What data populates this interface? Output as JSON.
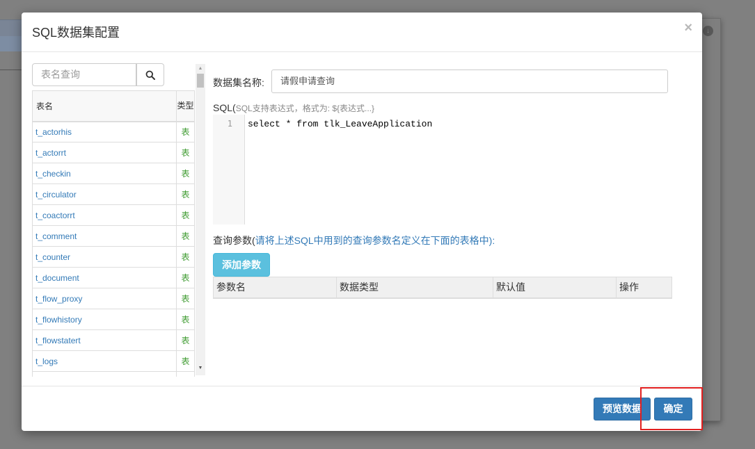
{
  "modal": {
    "title": "SQL数据集配置",
    "close_icon": "×"
  },
  "table_panel": {
    "search_placeholder": "表名查询",
    "headers": {
      "name": "表名",
      "type": "类型"
    },
    "rows": [
      {
        "name": "t_actorhis",
        "type": "表"
      },
      {
        "name": "t_actorrt",
        "type": "表"
      },
      {
        "name": "t_checkin",
        "type": "表"
      },
      {
        "name": "t_circulator",
        "type": "表"
      },
      {
        "name": "t_coactorrt",
        "type": "表"
      },
      {
        "name": "t_comment",
        "type": "表"
      },
      {
        "name": "t_counter",
        "type": "表"
      },
      {
        "name": "t_document",
        "type": "表"
      },
      {
        "name": "t_flow_proxy",
        "type": "表"
      },
      {
        "name": "t_flowhistory",
        "type": "表"
      },
      {
        "name": "t_flowstatert",
        "type": "表"
      },
      {
        "name": "t_logs",
        "type": "表"
      },
      {
        "name": "",
        "type": ""
      }
    ]
  },
  "form": {
    "name_label": "数据集名称:",
    "name_value": "请假申请查询",
    "sql_label": "SQL(",
    "sql_hint": "SQL支持表达式，格式为: ${表达式...}",
    "sql_line_number": "1",
    "sql_code": "select * from tlk_LeaveApplication",
    "params_label": "查询参数(",
    "params_hint": "请将上述SQL中用到的查询参数名定义在下面的表格中):",
    "add_param_label": "添加参数",
    "param_headers": [
      "参数名",
      "数据类型",
      "默认值",
      "操作"
    ]
  },
  "footer": {
    "preview_label": "预览数据",
    "ok_label": "确定"
  },
  "colors": {
    "primary": "#337ab7",
    "info": "#5bc0de",
    "highlight": "#e21f1f",
    "type_text": "#3c9a2e"
  }
}
